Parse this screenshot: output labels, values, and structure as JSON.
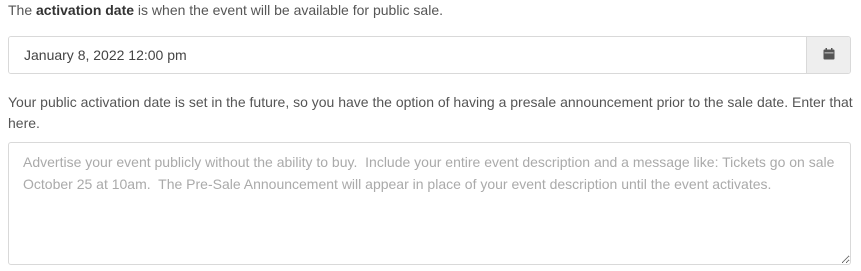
{
  "intro": {
    "prefix": "The ",
    "bold": "activation date",
    "suffix": " is when the event will be available for public sale."
  },
  "activation_date": {
    "value": "January 8, 2022 12:00 pm",
    "icon": "calendar-icon"
  },
  "presale": {
    "note": "Your public activation date is set in the future, so you have the option of having a presale announcement prior to the sale date. Enter that here.",
    "placeholder": "Advertise your event publicly without the ability to buy.  Include your entire event description and a message like: Tickets go on sale October 25 at 10am.  The Pre-Sale Announcement will appear in place of your event description until the event activates."
  }
}
